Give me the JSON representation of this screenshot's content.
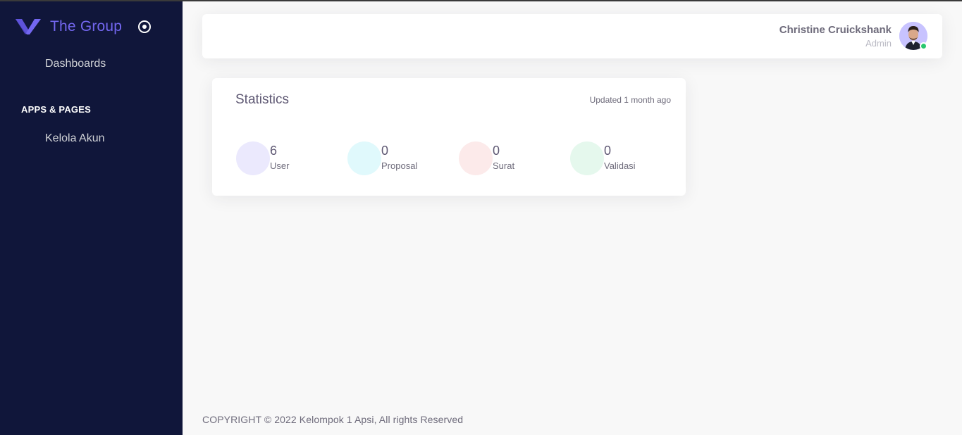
{
  "sidebar": {
    "brand_name": "The Group",
    "brand_logo_icon": "v-shape-logo-icon",
    "toggle_icon": "circle-dot-icon",
    "items": [
      {
        "label": "Dashboards"
      },
      {
        "section": "APPS & PAGES"
      },
      {
        "label": "Kelola Akun"
      }
    ]
  },
  "navbar": {
    "user_name": "Christine Cruickshank",
    "user_role": "Admin",
    "avatar_icon": "user-avatar",
    "status": "online"
  },
  "statistics": {
    "title": "Statistics",
    "updated": "Updated 1 month ago",
    "items": [
      {
        "value": "6",
        "label": "User",
        "color": "#ebe9fd"
      },
      {
        "value": "0",
        "label": "Proposal",
        "color": "#e0f9fc"
      },
      {
        "value": "0",
        "label": "Surat",
        "color": "#fceaea"
      },
      {
        "value": "0",
        "label": "Validasi",
        "color": "#e5f8ed"
      }
    ]
  },
  "footer": {
    "copyright": "COPYRIGHT © 2022 Kelompok 1 Apsi, All rights Reserved"
  },
  "colors": {
    "accent": "#7367f0",
    "sidebar_bg": "#10163a",
    "online": "#28c76f"
  }
}
